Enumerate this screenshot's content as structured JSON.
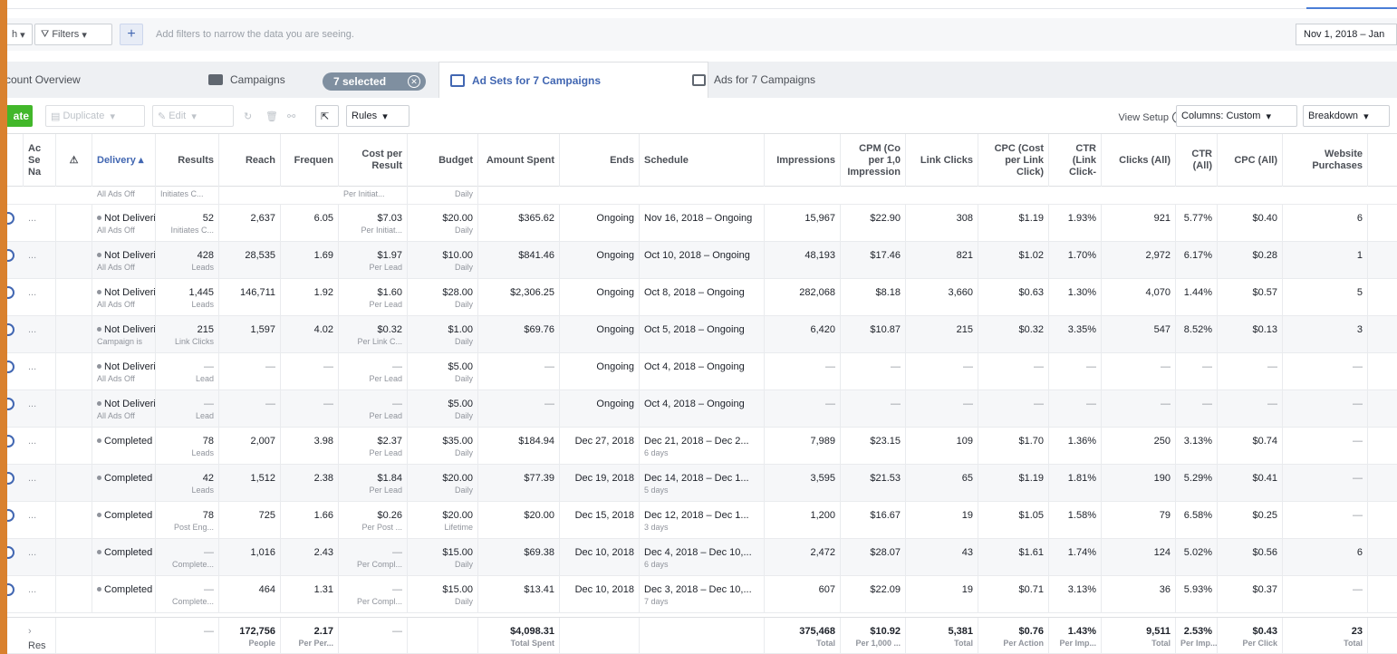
{
  "filterbar": {
    "left_stub": "h",
    "filters_label": "Filters",
    "plus": "+",
    "hint": "Add filters to narrow the data you are seeing.",
    "date_range": "Nov 1, 2018 – Jan"
  },
  "tabs": {
    "account": "count Overview",
    "campaigns": "Campaigns",
    "selected": "7 selected",
    "adsets": "Ad Sets for 7 Campaigns",
    "ads": "Ads for 7 Campaigns"
  },
  "toolbar": {
    "create": "ate",
    "duplicate": "Duplicate",
    "edit": "Edit",
    "rules": "Rules",
    "view_setup": "View Setup",
    "columns": "Columns: Custom",
    "breakdown": "Breakdown"
  },
  "headers": {
    "name": "Ac Se Na",
    "delivery": "Delivery",
    "results": "Results",
    "reach": "Reach",
    "frequency": "Frequen",
    "cost_per_result": "Cost per Result",
    "budget": "Budget",
    "amount_spent": "Amount Spent",
    "ends": "Ends",
    "schedule": "Schedule",
    "impressions": "Impressions",
    "cpm": "CPM (Co per 1,0 Impression",
    "link_clicks": "Link Clicks",
    "cpc_link": "CPC (Cost per Link Click)",
    "ctr_link": "CTR (Link Click-",
    "clicks_all": "Clicks (All)",
    "ctr_all": "CTR (All)",
    "cpc_all": "CPC (All)",
    "purchases": "Website Purchases"
  },
  "partial_row": {
    "delivery_sub": "All Ads Off",
    "results_sub": "Initiates C...",
    "cpr_sub": "Per Initiat...",
    "budget_sub": "Daily"
  },
  "rows": [
    {
      "delivery": "Not Deliveri",
      "delivery_sub": "All Ads Off",
      "results": "52",
      "results_sub": "Initiates C...",
      "reach": "2,637",
      "freq": "6.05",
      "cpr": "$7.03",
      "cpr_sub": "Per Initiat...",
      "budget": "$20.00",
      "budget_sub": "Daily",
      "spent": "$365.62",
      "ends": "Ongoing",
      "schedule": "Nov 16, 2018 – Ongoing",
      "schedule_sub": "",
      "impr": "15,967",
      "cpm": "$22.90",
      "link_clicks": "308",
      "cpc_link": "$1.19",
      "ctr_link": "1.93%",
      "clicks_all": "921",
      "ctr_all": "5.77%",
      "cpc_all": "$0.40",
      "purchases": "6"
    },
    {
      "delivery": "Not Deliveri",
      "delivery_sub": "All Ads Off",
      "results": "428",
      "results_sub": "Leads",
      "reach": "28,535",
      "freq": "1.69",
      "cpr": "$1.97",
      "cpr_sub": "Per Lead",
      "budget": "$10.00",
      "budget_sub": "Daily",
      "spent": "$841.46",
      "ends": "Ongoing",
      "schedule": "Oct 10, 2018 – Ongoing",
      "schedule_sub": "",
      "impr": "48,193",
      "cpm": "$17.46",
      "link_clicks": "821",
      "cpc_link": "$1.02",
      "ctr_link": "1.70%",
      "clicks_all": "2,972",
      "ctr_all": "6.17%",
      "cpc_all": "$0.28",
      "purchases": "1"
    },
    {
      "delivery": "Not Deliveri",
      "delivery_sub": "All Ads Off",
      "results": "1,445",
      "results_sub": "Leads",
      "reach": "146,711",
      "freq": "1.92",
      "cpr": "$1.60",
      "cpr_sub": "Per Lead",
      "budget": "$28.00",
      "budget_sub": "Daily",
      "spent": "$2,306.25",
      "ends": "Ongoing",
      "schedule": "Oct 8, 2018 – Ongoing",
      "schedule_sub": "",
      "impr": "282,068",
      "cpm": "$8.18",
      "link_clicks": "3,660",
      "cpc_link": "$0.63",
      "ctr_link": "1.30%",
      "clicks_all": "4,070",
      "ctr_all": "1.44%",
      "cpc_all": "$0.57",
      "purchases": "5"
    },
    {
      "delivery": "Not Deliveri",
      "delivery_sub": "Campaign is",
      "results": "215",
      "results_sub": "Link Clicks",
      "reach": "1,597",
      "freq": "4.02",
      "cpr": "$0.32",
      "cpr_sub": "Per Link C...",
      "budget": "$1.00",
      "budget_sub": "Daily",
      "spent": "$69.76",
      "ends": "Ongoing",
      "schedule": "Oct 5, 2018 – Ongoing",
      "schedule_sub": "",
      "impr": "6,420",
      "cpm": "$10.87",
      "link_clicks": "215",
      "cpc_link": "$0.32",
      "ctr_link": "3.35%",
      "clicks_all": "547",
      "ctr_all": "8.52%",
      "cpc_all": "$0.13",
      "purchases": "3"
    },
    {
      "delivery": "Not Deliveri",
      "delivery_sub": "All Ads Off",
      "results": "—",
      "results_sub": "Lead",
      "reach": "—",
      "freq": "—",
      "cpr": "—",
      "cpr_sub": "Per Lead",
      "budget": "$5.00",
      "budget_sub": "Daily",
      "spent": "—",
      "ends": "Ongoing",
      "schedule": "Oct 4, 2018 – Ongoing",
      "schedule_sub": "",
      "impr": "—",
      "cpm": "—",
      "link_clicks": "—",
      "cpc_link": "—",
      "ctr_link": "—",
      "clicks_all": "—",
      "ctr_all": "—",
      "cpc_all": "—",
      "purchases": "—"
    },
    {
      "delivery": "Not Deliveri",
      "delivery_sub": "All Ads Off",
      "results": "—",
      "results_sub": "Lead",
      "reach": "—",
      "freq": "—",
      "cpr": "—",
      "cpr_sub": "Per Lead",
      "budget": "$5.00",
      "budget_sub": "Daily",
      "spent": "—",
      "ends": "Ongoing",
      "schedule": "Oct 4, 2018 – Ongoing",
      "schedule_sub": "",
      "impr": "—",
      "cpm": "—",
      "link_clicks": "—",
      "cpc_link": "—",
      "ctr_link": "—",
      "clicks_all": "—",
      "ctr_all": "—",
      "cpc_all": "—",
      "purchases": "—"
    },
    {
      "delivery": "Completed",
      "delivery_sub": "",
      "results": "78",
      "results_sub": "Leads",
      "reach": "2,007",
      "freq": "3.98",
      "cpr": "$2.37",
      "cpr_sub": "Per Lead",
      "budget": "$35.00",
      "budget_sub": "Daily",
      "spent": "$184.94",
      "ends": "Dec 27, 2018",
      "schedule": "Dec 21, 2018 – Dec 2...",
      "schedule_sub": "6 days",
      "impr": "7,989",
      "cpm": "$23.15",
      "link_clicks": "109",
      "cpc_link": "$1.70",
      "ctr_link": "1.36%",
      "clicks_all": "250",
      "ctr_all": "3.13%",
      "cpc_all": "$0.74",
      "purchases": "—"
    },
    {
      "delivery": "Completed",
      "delivery_sub": "",
      "results": "42",
      "results_sub": "Leads",
      "reach": "1,512",
      "freq": "2.38",
      "cpr": "$1.84",
      "cpr_sub": "Per Lead",
      "budget": "$20.00",
      "budget_sub": "Daily",
      "spent": "$77.39",
      "ends": "Dec 19, 2018",
      "schedule": "Dec 14, 2018 – Dec 1...",
      "schedule_sub": "5 days",
      "impr": "3,595",
      "cpm": "$21.53",
      "link_clicks": "65",
      "cpc_link": "$1.19",
      "ctr_link": "1.81%",
      "clicks_all": "190",
      "ctr_all": "5.29%",
      "cpc_all": "$0.41",
      "purchases": "—"
    },
    {
      "delivery": "Completed",
      "delivery_sub": "",
      "results": "78",
      "results_sub": "Post Eng...",
      "reach": "725",
      "freq": "1.66",
      "cpr": "$0.26",
      "cpr_sub": "Per Post ...",
      "budget": "$20.00",
      "budget_sub": "Lifetime",
      "spent": "$20.00",
      "ends": "Dec 15, 2018",
      "schedule": "Dec 12, 2018 – Dec 1...",
      "schedule_sub": "3 days",
      "impr": "1,200",
      "cpm": "$16.67",
      "link_clicks": "19",
      "cpc_link": "$1.05",
      "ctr_link": "1.58%",
      "clicks_all": "79",
      "ctr_all": "6.58%",
      "cpc_all": "$0.25",
      "purchases": "—"
    },
    {
      "delivery": "Completed",
      "delivery_sub": "",
      "results": "—",
      "results_sub": "Complete...",
      "reach": "1,016",
      "freq": "2.43",
      "cpr": "—",
      "cpr_sub": "Per Compl...",
      "budget": "$15.00",
      "budget_sub": "Daily",
      "spent": "$69.38",
      "ends": "Dec 10, 2018",
      "schedule": "Dec 4, 2018 – Dec 10,...",
      "schedule_sub": "6 days",
      "impr": "2,472",
      "cpm": "$28.07",
      "link_clicks": "43",
      "cpc_link": "$1.61",
      "ctr_link": "1.74%",
      "clicks_all": "124",
      "ctr_all": "5.02%",
      "cpc_all": "$0.56",
      "purchases": "6"
    },
    {
      "delivery": "Completed",
      "delivery_sub": "",
      "results": "—",
      "results_sub": "Complete...",
      "reach": "464",
      "freq": "1.31",
      "cpr": "—",
      "cpr_sub": "Per Compl...",
      "budget": "$15.00",
      "budget_sub": "Daily",
      "spent": "$13.41",
      "ends": "Dec 10, 2018",
      "schedule": "Dec 3, 2018 – Dec 10,...",
      "schedule_sub": "7 days",
      "impr": "607",
      "cpm": "$22.09",
      "link_clicks": "19",
      "cpc_link": "$0.71",
      "ctr_link": "3.13%",
      "clicks_all": "36",
      "ctr_all": "5.93%",
      "cpc_all": "$0.37",
      "purchases": "—"
    }
  ],
  "footer": {
    "results": "—",
    "reach": "172,756",
    "reach_sub": "People",
    "freq": "2.17",
    "freq_sub": "Per Per...",
    "cpr": "—",
    "spent": "$4,098.31",
    "spent_sub": "Total Spent",
    "impr": "375,468",
    "impr_sub": "Total",
    "cpm": "$10.92",
    "cpm_sub": "Per 1,000 ...",
    "link_clicks": "5,381",
    "link_clicks_sub": "Total",
    "cpc_link": "$0.76",
    "cpc_link_sub": "Per Action",
    "ctr_link": "1.43%",
    "ctr_link_sub": "Per Imp...",
    "clicks_all": "9,511",
    "clicks_all_sub": "Total",
    "ctr_all": "2.53%",
    "ctr_all_sub": "Per Imp...",
    "cpc_all": "$0.43",
    "cpc_all_sub": "Per Click",
    "purchases": "23",
    "purchases_sub": "Total",
    "name_stub": "Res"
  },
  "colors": {
    "accent": "#4267b2",
    "create_green": "#42b72a",
    "left_bar": "#d9812e"
  }
}
